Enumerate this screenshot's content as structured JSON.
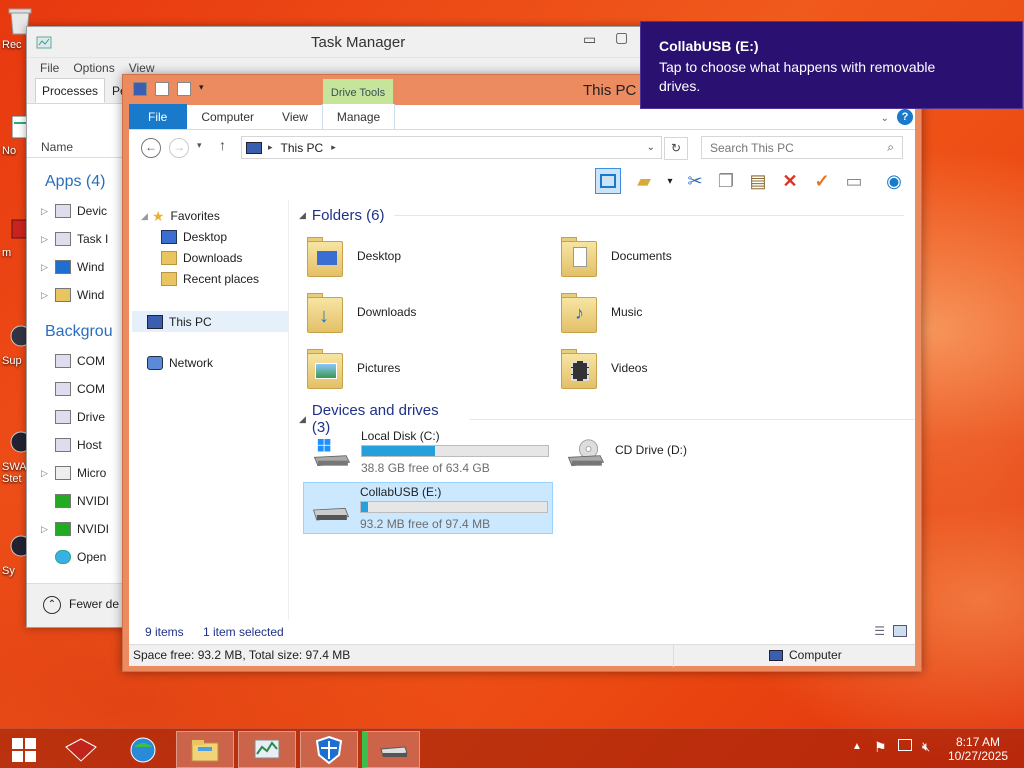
{
  "desktop": {
    "icons": [
      {
        "label": "Rec",
        "icon": "recycle-bin-icon"
      },
      {
        "label": "No",
        "icon": "notes-icon"
      },
      {
        "label": "m",
        "icon": "app-icon"
      },
      {
        "label": "Sup",
        "icon": "support-icon"
      },
      {
        "label": "SWA Stet",
        "icon": "app-icon"
      },
      {
        "label": "Sy",
        "icon": "app-icon"
      }
    ]
  },
  "task_manager": {
    "title": "Task Manager",
    "menu": [
      "File",
      "Options",
      "View"
    ],
    "tabs": [
      "Processes",
      "Pe"
    ],
    "column_name": "Name",
    "apps_group": "Apps (4)",
    "apps": [
      "Devic",
      "Task I",
      "Wind",
      "Wind"
    ],
    "background_group": "Backgrou",
    "background": [
      "COM",
      "COM",
      "Drive",
      "Host",
      "Micro",
      "NVIDI",
      "NVIDI",
      "Open"
    ],
    "fewer_details": "Fewer de"
  },
  "explorer": {
    "title": "This PC",
    "drive_tools": "Drive Tools",
    "ribbon_tabs": [
      "File",
      "Computer",
      "View",
      "Manage"
    ],
    "address": "This PC",
    "search_placeholder": "Search This PC",
    "nav": {
      "favorites": "Favorites",
      "desktop": "Desktop",
      "downloads": "Downloads",
      "recent": "Recent places",
      "this_pc": "This PC",
      "network": "Network"
    },
    "folders_header": "Folders (6)",
    "folders": [
      "Desktop",
      "Documents",
      "Downloads",
      "Music",
      "Pictures",
      "Videos"
    ],
    "devices_header": "Devices and drives (3)",
    "drives": [
      {
        "name": "Local Disk (C:)",
        "free": "38.8 GB free of 63.4 GB",
        "used_fraction": 0.39
      },
      {
        "name": "CD Drive (D:)"
      },
      {
        "name": "CollabUSB (E:)",
        "free": "93.2 MB free of 97.4 MB",
        "used_fraction": 0.04
      }
    ],
    "item_count": "9 items",
    "selected_count": "1 item selected",
    "details": "Space free: 93.2 MB, Total size: 97.4 MB",
    "location": "Computer",
    "accent": "#1979ca",
    "drive_bar_color": "#26a0da"
  },
  "toast": {
    "title": "CollabUSB (E:)",
    "message": "Tap to choose what happens with removable drives.",
    "background": "#2a1171"
  },
  "taskbar": {
    "time": "8:17 AM",
    "date": "10/27/2025"
  }
}
